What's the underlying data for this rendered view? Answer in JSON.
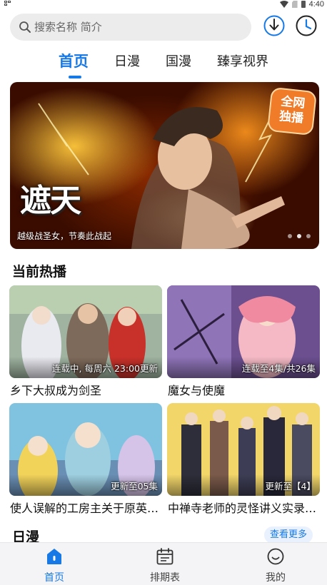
{
  "status_bar": {
    "time": "4:40"
  },
  "search": {
    "placeholder": "搜索名称 简介"
  },
  "tabs": [
    {
      "label": "首页",
      "active": true
    },
    {
      "label": "日漫"
    },
    {
      "label": "国漫"
    },
    {
      "label": "臻享视界"
    }
  ],
  "banner": {
    "badge_line1": "全网",
    "badge_line2": "独播",
    "logo_text": "遮天",
    "caption": "越级战圣女，节奏此战起",
    "dot_count": 3,
    "active_dot": 1
  },
  "sections": {
    "hot": {
      "title": "当前热播",
      "items": [
        {
          "status": "连载中, 每周六 23:00更新",
          "title": "乡下大叔成为剑圣"
        },
        {
          "status": "连载至4集/共26集",
          "title": "魔女与使魔"
        },
        {
          "status": "更新至05集",
          "title": "使人误解的工房主关于原英…"
        },
        {
          "status": "更新至【4】",
          "title": "中禅寺老师的灵怪讲义实录…"
        }
      ]
    },
    "japanese": {
      "title": "日漫",
      "see_more": "查看更多"
    }
  },
  "bottom_nav": [
    {
      "label": "首页",
      "icon": "home-icon",
      "active": true
    },
    {
      "label": "排期表",
      "icon": "calendar-icon"
    },
    {
      "label": "我的",
      "icon": "profile-icon"
    }
  ],
  "colors": {
    "accent": "#1779e6",
    "badge": "#f07c2a",
    "nav_bg": "#f4f4f6"
  }
}
